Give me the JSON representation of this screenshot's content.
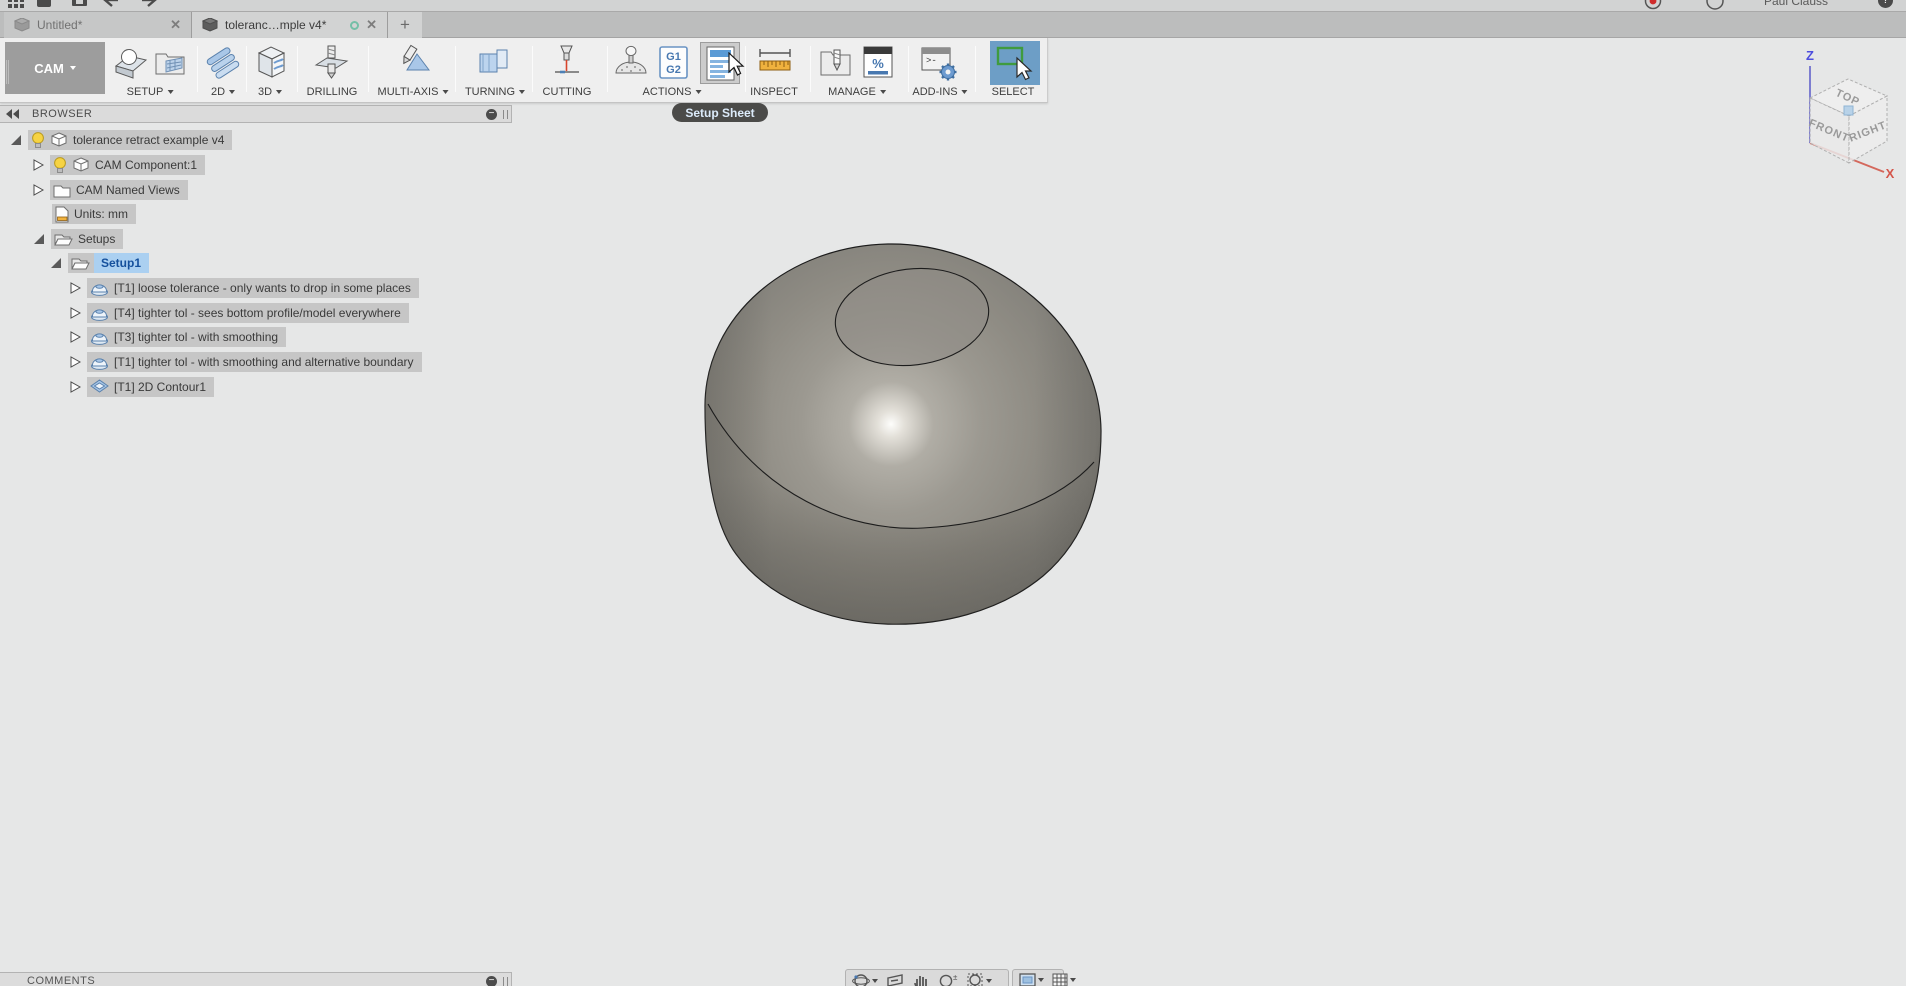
{
  "titlebar": {
    "user_name": "Paul Clauss",
    "help_glyph": "?"
  },
  "tabs": {
    "inactive_label": "Untitled*",
    "active_label": "toleranc…mple v4*",
    "close_glyph": "✕",
    "new_tab_glyph": "+"
  },
  "toolbar": {
    "workspace_label": "CAM",
    "tooltip": "Setup Sheet",
    "groups": [
      {
        "label": "SETUP"
      },
      {
        "label": "2D"
      },
      {
        "label": "3D"
      },
      {
        "label": "DRILLING"
      },
      {
        "label": "MULTI-AXIS"
      },
      {
        "label": "TURNING"
      },
      {
        "label": "CUTTING"
      },
      {
        "label": "ACTIONS"
      },
      {
        "label": "INSPECT"
      },
      {
        "label": "MANAGE"
      },
      {
        "label": "ADD-INS"
      },
      {
        "label": "SELECT"
      }
    ],
    "icon_glyphs": {
      "g1": "G1",
      "g2": "G2",
      "percent": "%",
      "prompt": ">-"
    }
  },
  "browser": {
    "title": "BROWSER",
    "tree": [
      {
        "label": "tolerance retract example v4"
      },
      {
        "label": "CAM Component:1"
      },
      {
        "label": "CAM Named Views"
      },
      {
        "label": "Units: mm"
      },
      {
        "label": "Setups"
      },
      {
        "label": "Setup1",
        "selected": true
      },
      {
        "label": "[T1] loose tolerance - only wants to drop in some places"
      },
      {
        "label": "[T4] tighter tol - sees bottom profile/model everywhere"
      },
      {
        "label": "[T3] tighter tol - with smoothing"
      },
      {
        "label": "[T1] tighter tol - with smoothing and alternative boundary"
      },
      {
        "label": "[T1] 2D Contour1"
      }
    ]
  },
  "comments": {
    "title": "COMMENTS"
  },
  "viewcube": {
    "top": "TOP",
    "front": "FRONT",
    "right": "RIGHT",
    "z_axis": "Z",
    "x_axis": "X"
  },
  "colors": {
    "viewport_bg": "#e6e7e7",
    "selection_blue": "#abd0f1",
    "selected_text": "#15509c",
    "select_button_bg": "#6d9ec6",
    "tooltip_bg": "#4b4b49",
    "ruler_orange": "#f0b23e",
    "axis_z_blue": "#5555dd",
    "axis_x_red": "#d4685c"
  }
}
